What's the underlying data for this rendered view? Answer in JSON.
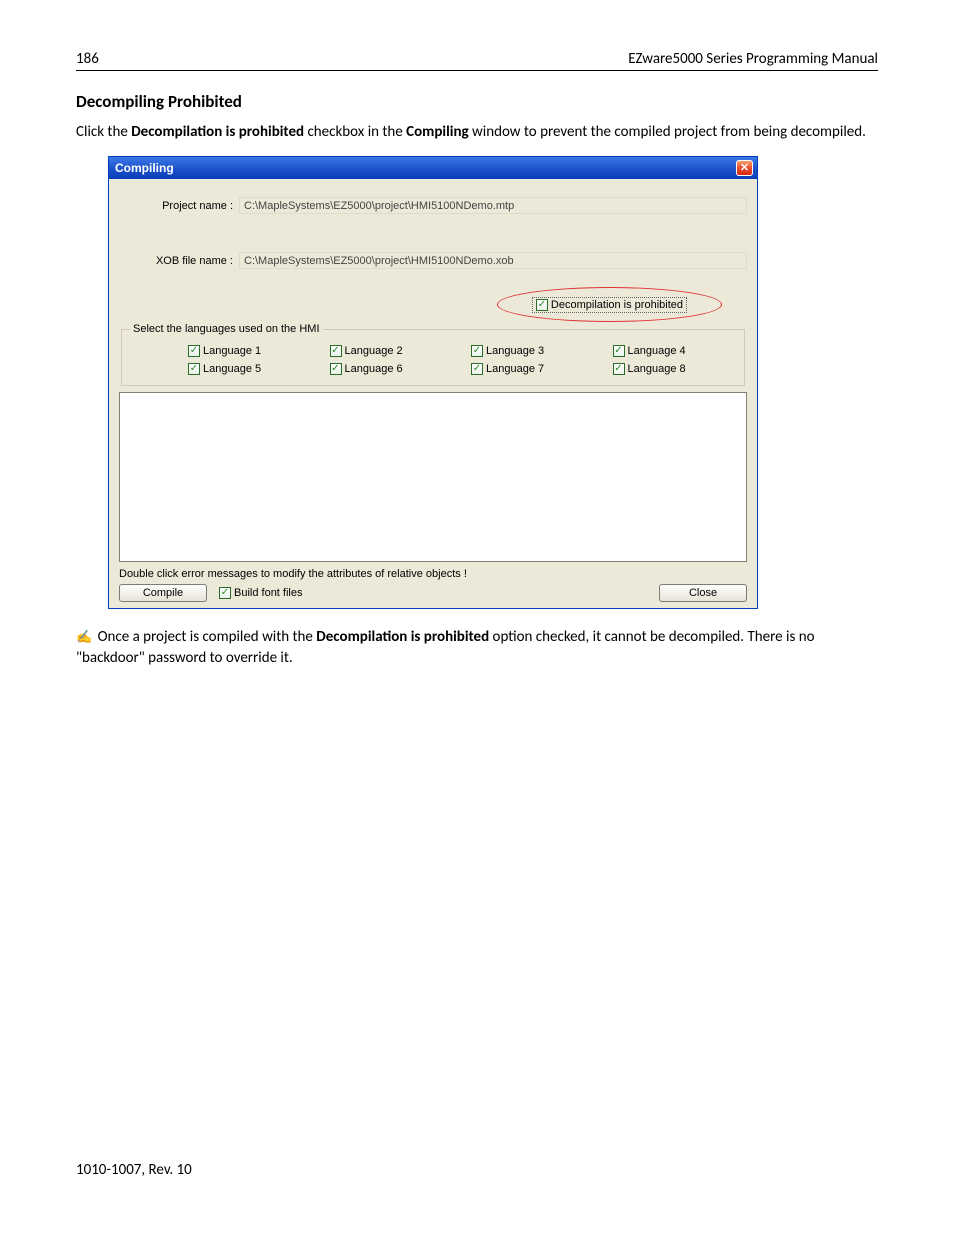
{
  "header": {
    "page_number": "186",
    "doc_title": "EZware5000 Series Programming Manual"
  },
  "section": {
    "heading": "Decompiling Prohibited",
    "para1_pre": "Click the ",
    "para1_bold1": "Decompilation is prohibited",
    "para1_mid": " checkbox in the ",
    "para1_bold2": "Compiling",
    "para1_post": " window to prevent the compiled project from being decompiled."
  },
  "dialog": {
    "title": "Compiling",
    "project_label": "Project name :",
    "project_value": "C:\\MapleSystems\\EZ5000\\project\\HMI5100NDemo.mtp",
    "xob_label": "XOB file name :",
    "xob_value": "C:\\MapleSystems\\EZ5000\\project\\HMI5100NDemo.xob",
    "prohibit_label": "Decompilation is prohibited",
    "lang_legend": "Select the languages used on the HMI",
    "languages": [
      "Language 1",
      "Language 2",
      "Language 3",
      "Language 4",
      "Language 5",
      "Language 6",
      "Language 7",
      "Language 8"
    ],
    "dblclick_hint": "Double click  error messages  to modify the attributes of  relative objects !",
    "compile_btn": "Compile",
    "build_font_label": "Build font files",
    "close_btn": "Close"
  },
  "note": {
    "pre": " Once a project is compiled with the ",
    "bold": "Decompilation is prohibited",
    "post": " option checked, it cannot be decompiled. There is no \"backdoor\" password to override it."
  },
  "footer": {
    "rev": "1010-1007, Rev. 10"
  }
}
